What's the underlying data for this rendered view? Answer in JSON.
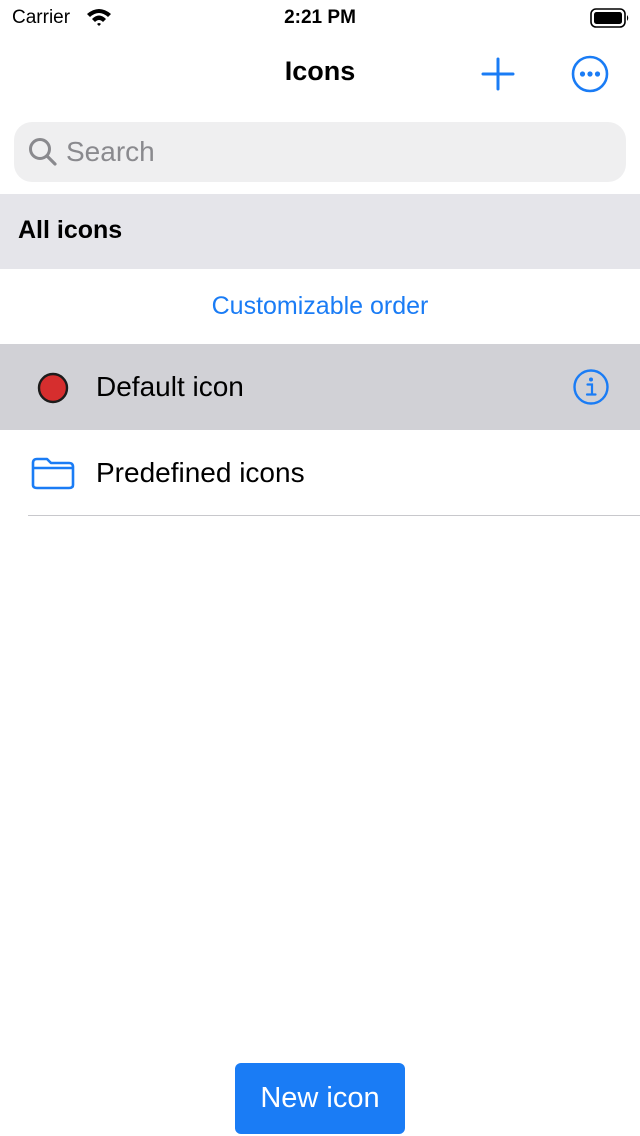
{
  "status_bar": {
    "carrier": "Carrier",
    "time": "2:21 PM"
  },
  "nav": {
    "title": "Icons",
    "add_icon": "plus-icon",
    "more_icon": "ellipsis-circle-icon"
  },
  "search": {
    "placeholder": "Search",
    "value": ""
  },
  "section": {
    "title": "All icons"
  },
  "order_link": "Customizable order",
  "rows": [
    {
      "label": "Default icon",
      "icon": "red-circle-icon",
      "icon_color": "#d62e2e",
      "selected": true,
      "accessory": "info-icon"
    },
    {
      "label": "Predefined icons",
      "icon": "folder-icon",
      "selected": false
    }
  ],
  "bottom_button": {
    "label": "New icon"
  },
  "colors": {
    "accent": "#1a7cf5",
    "selected_row": "#d1d1d6",
    "section_header": "#e5e5ea",
    "search_bg": "#efeff0"
  }
}
